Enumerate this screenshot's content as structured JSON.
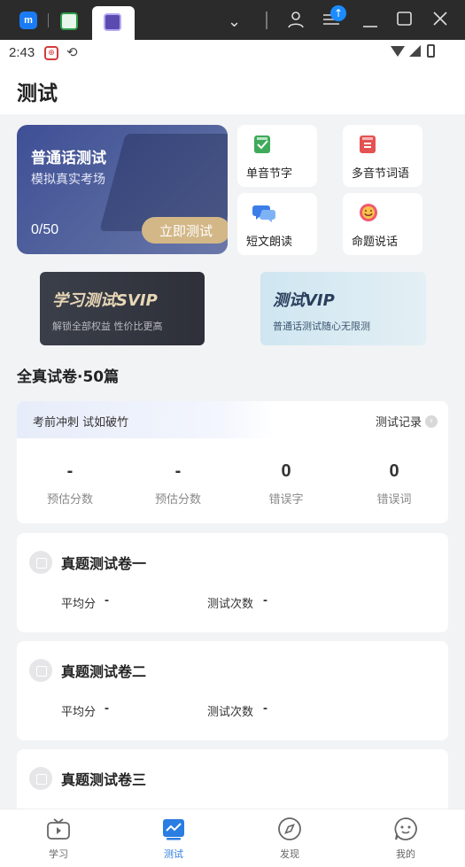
{
  "page": {
    "title": "测试"
  },
  "status_bar": {
    "time": "2:43"
  },
  "main_card": {
    "title": "普通话测试",
    "subtitle": "模拟真实考场",
    "progress": "0/50",
    "start_button": "立即测试"
  },
  "modes": [
    {
      "label": "单音节字",
      "icon": "green-book-icon",
      "color": "#3faa5a"
    },
    {
      "label": "多音节词语",
      "icon": "red-book-icon",
      "color": "#e45252"
    },
    {
      "label": "短文朗读",
      "icon": "chat-bubbles-icon",
      "color": "#3c7ee8"
    },
    {
      "label": "命题说话",
      "icon": "smiley-bubble-icon",
      "color": "#ef5a6e"
    }
  ],
  "promo": {
    "svip_title": "学习测试SVIP",
    "svip_sub": "解锁全部权益 性价比更高",
    "vip_title": "测试VIP",
    "vip_sub": "普通话测试随心无限测"
  },
  "section": {
    "title": "全真试卷·50篇"
  },
  "stats": {
    "banner": "考前冲刺 试如破竹",
    "record_link": "测试记录",
    "items": [
      {
        "value": "-",
        "label": "预估分数"
      },
      {
        "value": "-",
        "label": "预估分数"
      },
      {
        "value": "0",
        "label": "错误字"
      },
      {
        "value": "0",
        "label": "错误词"
      }
    ]
  },
  "papers": [
    {
      "name": "真题测试卷一",
      "avg_label": "平均分",
      "avg_value": "-",
      "count_label": "测试次数",
      "count_value": "-"
    },
    {
      "name": "真题测试卷二",
      "avg_label": "平均分",
      "avg_value": "-",
      "count_label": "测试次数",
      "count_value": "-"
    },
    {
      "name": "真题测试卷三"
    }
  ],
  "nav": [
    {
      "label": "学习",
      "icon": "tv-icon"
    },
    {
      "label": "测试",
      "icon": "chart-icon",
      "active": true
    },
    {
      "label": "发现",
      "icon": "compass-icon"
    },
    {
      "label": "我的",
      "icon": "face-icon"
    }
  ],
  "colors": {
    "accent": "#2a7de1",
    "main_card": "#4a5a9c",
    "start_button": "#d3b787"
  }
}
